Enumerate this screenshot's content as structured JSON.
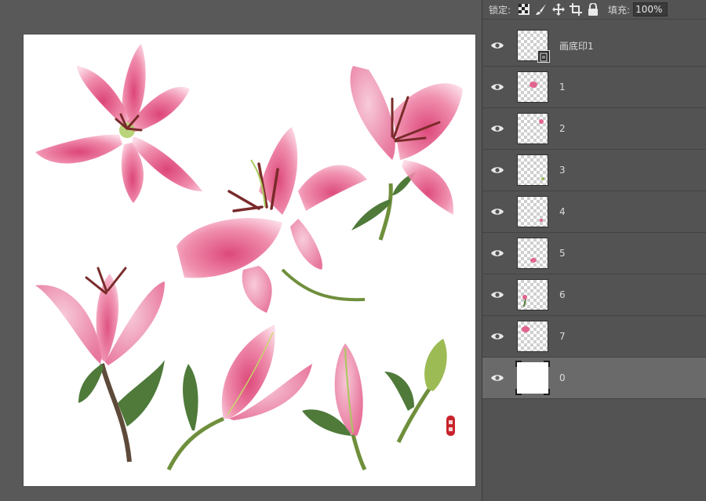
{
  "lock_bar": {
    "lock_label": "锁定:",
    "fill_label": "填充:",
    "fill_value": "100%"
  },
  "layers": [
    {
      "name": "画底印1",
      "type": "smart-object"
    },
    {
      "name": "1",
      "type": "pixel"
    },
    {
      "name": "2",
      "type": "pixel"
    },
    {
      "name": "3",
      "type": "pixel"
    },
    {
      "name": "4",
      "type": "pixel"
    },
    {
      "name": "5",
      "type": "pixel"
    },
    {
      "name": "6",
      "type": "pixel"
    },
    {
      "name": "7",
      "type": "pixel"
    },
    {
      "name": "0",
      "type": "background",
      "selected": true
    }
  ],
  "colors": {
    "petal": "#e2658f",
    "petal_light": "#f6b9cc",
    "stem": "#6f8f3c",
    "leaf": "#4f7a3a",
    "stamen": "#7a2b2b",
    "seal": "#c8232c"
  }
}
